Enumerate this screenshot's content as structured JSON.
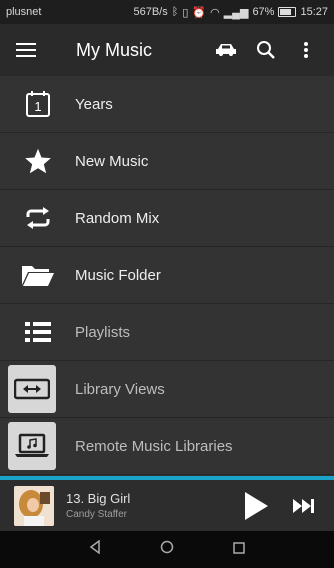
{
  "status": {
    "carrier": "plusnet",
    "speed": "567B/s",
    "battery": "67%",
    "time": "15:27"
  },
  "appbar": {
    "title": "My Music",
    "icons": [
      "menu-icon",
      "car-icon",
      "search-icon",
      "more-vert-icon"
    ]
  },
  "menu": [
    {
      "label": "Years",
      "icon": "calendar-icon"
    },
    {
      "label": "New Music",
      "icon": "star-icon"
    },
    {
      "label": "Random Mix",
      "icon": "repeat-icon"
    },
    {
      "label": "Music Folder",
      "icon": "folder-icon"
    },
    {
      "label": "Playlists",
      "icon": "list-icon"
    },
    {
      "label": "Library Views",
      "icon": "arrows-icon"
    },
    {
      "label": "Remote Music Libraries",
      "icon": "laptop-music-icon"
    }
  ],
  "player": {
    "track": "13. Big Girl",
    "artist": "Candy Staffer",
    "accent": "#1aa3c8"
  },
  "calendar_day": "1"
}
